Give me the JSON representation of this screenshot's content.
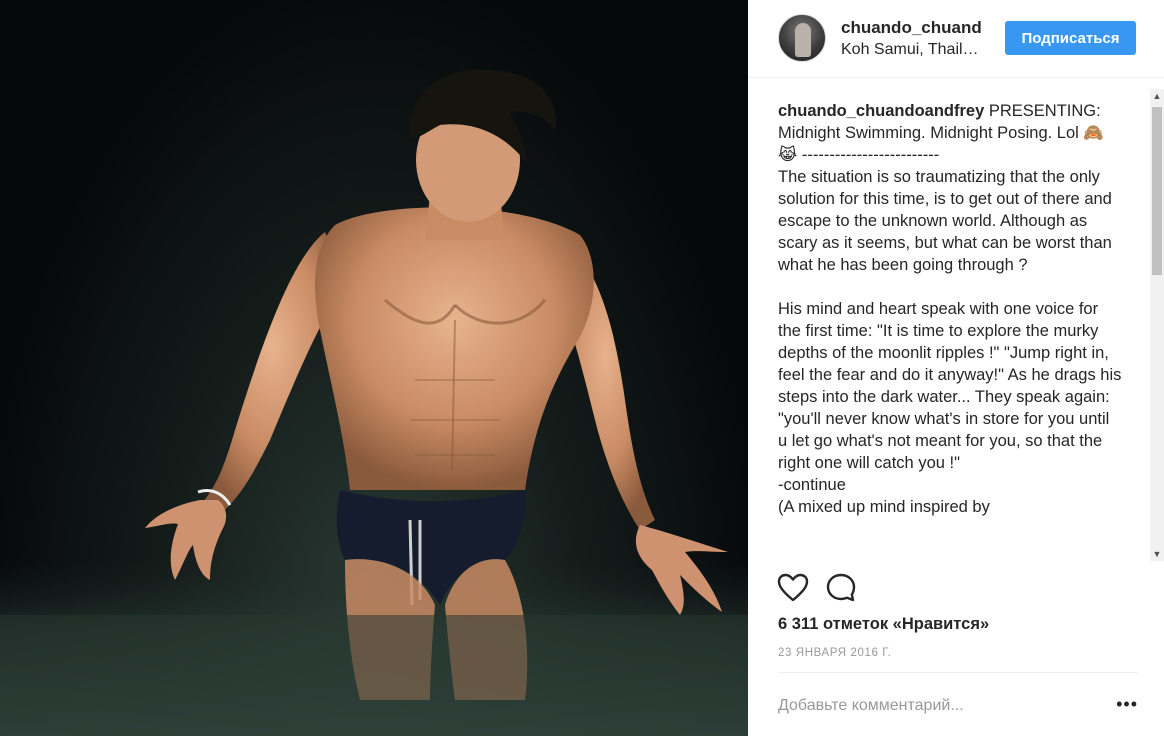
{
  "post": {
    "image_alt": "Shirtless man in dark swim trunks standing waist-deep in water at night"
  },
  "header": {
    "username": "chuando_chuandoandfrey",
    "location": "Koh Samui, Thailand",
    "follow_label": "Подписаться"
  },
  "caption": {
    "username": "chuando_chuandoandfrey",
    "text": " PRESENTING: Midnight Swimming. Midnight Posing. Lol 🙈😹 -------------------------\nThe situation is so traumatizing that the only solution for this time, is to get out of there and escape to the unknown world. Although as scary as it seems, but what can be worst than what he has been going through ?\n\nHis mind and heart speak with one voice for the first time: \"It is time to explore the murky depths of the moonlit ripples !\" \"Jump right in, feel the fear and do it anyway!\" As he drags his steps into the dark water... They speak again: \"you'll never know what's in store for you until u let go what's not meant for you, so that the right one will catch you !\"\n-continue\n(A mixed up mind inspired by"
  },
  "actions": {
    "like_icon": "heart-icon",
    "comment_icon": "comment-bubble-icon"
  },
  "likes_text": "6 311 отметок «Нравится»",
  "date_text": "23 января 2016 г.",
  "comment": {
    "placeholder": "Добавьте комментарий...",
    "more_label": "•••"
  },
  "colors": {
    "follow_button": "#3897f0",
    "text": "#262626",
    "muted": "#999999"
  }
}
